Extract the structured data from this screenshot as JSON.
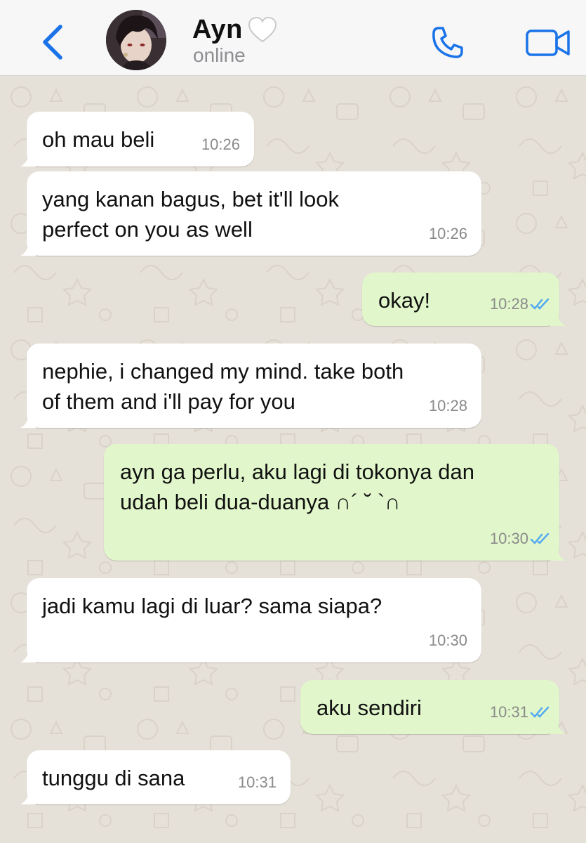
{
  "header": {
    "contact_name": "Ayn",
    "status": "online"
  },
  "colors": {
    "accent": "#1a73e8",
    "incoming_bubble": "#ffffff",
    "outgoing_bubble": "#e1f7cb",
    "chat_background": "#e6e1d8",
    "read_ticks": "#4fa8f0"
  },
  "icons": {
    "back": "chevron-left-icon",
    "call": "phone-icon",
    "video": "video-camera-icon",
    "status_heart": "white-heart-icon",
    "read_receipt": "double-check-icon"
  },
  "messages": [
    {
      "direction": "in",
      "text": "oh mau beli",
      "time": "10:26"
    },
    {
      "direction": "in",
      "text": "yang kanan bagus, bet it'll look\nperfect on you as well",
      "time": "10:26"
    },
    {
      "direction": "out",
      "text": "okay!",
      "time": "10:28",
      "read": true
    },
    {
      "direction": "in",
      "text": "nephie, i changed my mind. take both\nof them and i'll pay for you",
      "time": "10:28"
    },
    {
      "direction": "out",
      "text": "ayn ga perlu, aku lagi di tokonya dan\nudah beli dua-duanya ∩´ ˘ `∩",
      "time": "10:30",
      "read": true
    },
    {
      "direction": "in",
      "text": "jadi kamu lagi di luar? sama siapa?",
      "time": "10:30"
    },
    {
      "direction": "out",
      "text": "aku sendiri",
      "time": "10:31",
      "read": true
    },
    {
      "direction": "in",
      "text": "tunggu di sana",
      "time": "10:31"
    }
  ]
}
